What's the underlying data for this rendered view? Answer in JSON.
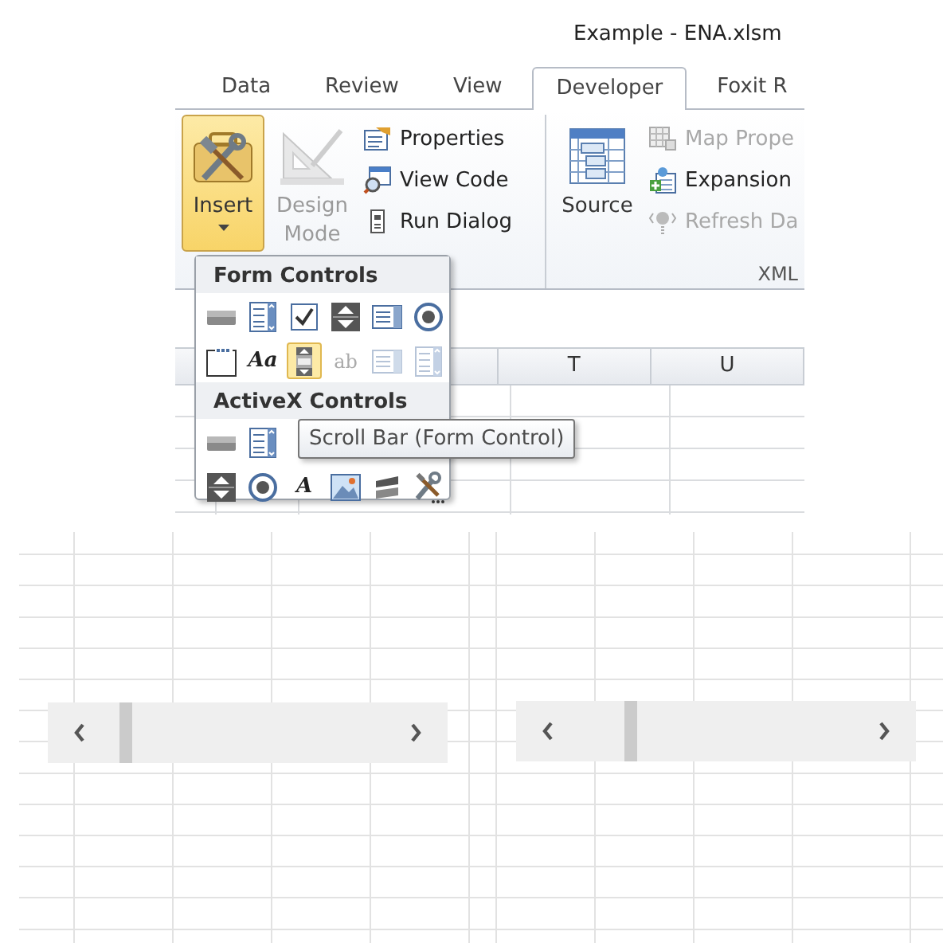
{
  "window": {
    "title": "Example - ENA.xlsm"
  },
  "tabs": [
    {
      "label": "Data",
      "selected": false
    },
    {
      "label": "Review",
      "selected": false
    },
    {
      "label": "View",
      "selected": false
    },
    {
      "label": "Developer",
      "selected": true
    },
    {
      "label": "Foxit R",
      "selected": false
    }
  ],
  "ribbon": {
    "code_group": {
      "large_buttons": [
        {
          "kind": "insert",
          "label": "Insert",
          "pressed": true,
          "disabled": false
        },
        {
          "kind": "design",
          "label": "Design Mode",
          "pressed": false,
          "disabled": true
        }
      ],
      "small_buttons": [
        {
          "kind": "properties",
          "label": "Properties",
          "disabled": false
        },
        {
          "kind": "viewcode",
          "label": "View Code",
          "disabled": false
        },
        {
          "kind": "rundialog",
          "label": "Run Dialog",
          "disabled": false
        }
      ]
    },
    "xml_group": {
      "label": "XML",
      "large_buttons": [
        {
          "kind": "source",
          "label": "Source",
          "pressed": false,
          "disabled": false
        }
      ],
      "small_buttons": [
        {
          "kind": "map",
          "label": "Map Prope",
          "disabled": true
        },
        {
          "kind": "expansion",
          "label": "Expansion",
          "disabled": false
        },
        {
          "kind": "refresh",
          "label": "Refresh Da",
          "disabled": true
        }
      ]
    }
  },
  "columns": [
    "T",
    "U"
  ],
  "insert_menu": {
    "sections": [
      {
        "title": "Form Controls",
        "rows": [
          [
            {
              "kind": "button",
              "selected": false,
              "disabled": false
            },
            {
              "kind": "combo",
              "selected": false,
              "disabled": false
            },
            {
              "kind": "checkbox",
              "selected": false,
              "disabled": false
            },
            {
              "kind": "spin",
              "selected": false,
              "disabled": false
            },
            {
              "kind": "listbox",
              "selected": false,
              "disabled": false
            },
            {
              "kind": "option",
              "selected": false,
              "disabled": false
            }
          ],
          [
            {
              "kind": "group",
              "selected": false,
              "disabled": false
            },
            {
              "kind": "label",
              "glyph": "Aa",
              "selected": false,
              "disabled": false
            },
            {
              "kind": "scrollbar",
              "selected": true,
              "disabled": false
            },
            {
              "kind": "textfield",
              "glyph": "ab",
              "selected": false,
              "disabled": true
            },
            {
              "kind": "listbox",
              "selected": false,
              "disabled": true
            },
            {
              "kind": "combo",
              "selected": false,
              "disabled": true
            }
          ]
        ]
      },
      {
        "title": "ActiveX Controls",
        "rows": [
          [
            {
              "kind": "button",
              "selected": false,
              "disabled": false
            },
            {
              "kind": "combo",
              "selected": false,
              "disabled": false
            }
          ],
          [
            {
              "kind": "spin",
              "selected": false,
              "disabled": false
            },
            {
              "kind": "option",
              "selected": false,
              "disabled": false
            },
            {
              "kind": "label",
              "glyph": "A",
              "selected": false,
              "disabled": false
            },
            {
              "kind": "image",
              "selected": false,
              "disabled": false
            },
            {
              "kind": "toggle",
              "selected": false,
              "disabled": false
            },
            {
              "kind": "more",
              "selected": false,
              "disabled": false
            }
          ]
        ]
      }
    ]
  },
  "tooltip": "Scroll Bar (Form Control)",
  "sheet_controls": [
    {
      "kind": "scroll_bar"
    },
    {
      "kind": "scroll_bar"
    }
  ]
}
